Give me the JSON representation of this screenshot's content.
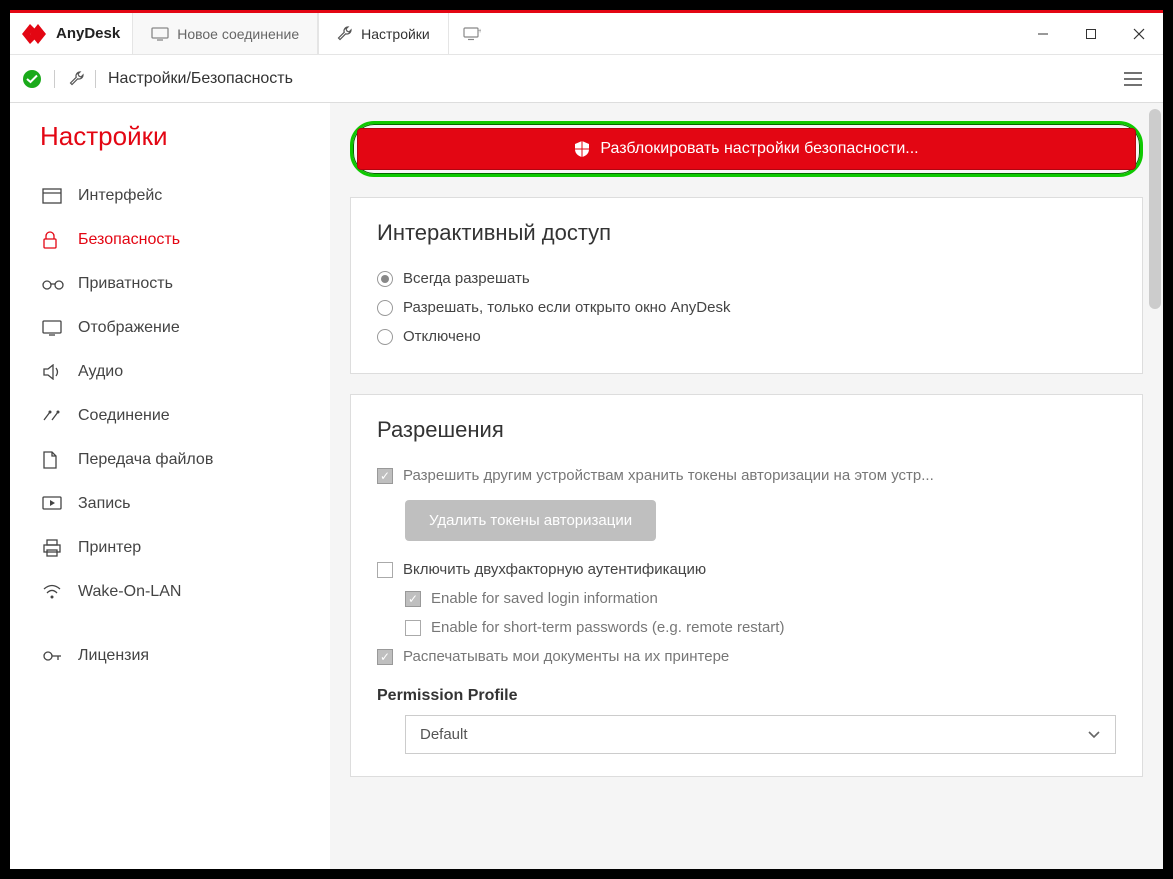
{
  "app": {
    "name": "AnyDesk"
  },
  "tabs": {
    "new_connection": "Новое соединение",
    "settings": "Настройки"
  },
  "breadcrumb": "Настройки/Безопасность",
  "sidebar": {
    "title": "Настройки",
    "items": [
      {
        "label": "Интерфейс"
      },
      {
        "label": "Безопасность"
      },
      {
        "label": "Приватность"
      },
      {
        "label": "Отображение"
      },
      {
        "label": "Аудио"
      },
      {
        "label": "Соединение"
      },
      {
        "label": "Передача файлов"
      },
      {
        "label": "Запись"
      },
      {
        "label": "Принтер"
      },
      {
        "label": "Wake-On-LAN"
      },
      {
        "label": "Лицензия"
      }
    ]
  },
  "unlock": {
    "label": "Разблокировать настройки безопасности..."
  },
  "interactive": {
    "title": "Интерактивный доступ",
    "options": [
      "Всегда разрешать",
      "Разрешать, только если открыто окно AnyDesk",
      "Отключено"
    ]
  },
  "permissions": {
    "title": "Разрешения",
    "allow_tokens": "Разрешить другим устройствам хранить токены авторизации на этом устр...",
    "delete_tokens": "Удалить токены авторизации",
    "enable_2fa": "Включить двухфакторную аутентификацию",
    "enable_saved": "Enable for saved login information",
    "enable_short": "Enable for short-term passwords (e.g. remote restart)",
    "print_docs": "Распечатывать мои документы на их принтере",
    "profile_label": "Permission Profile",
    "profile_value": "Default"
  }
}
